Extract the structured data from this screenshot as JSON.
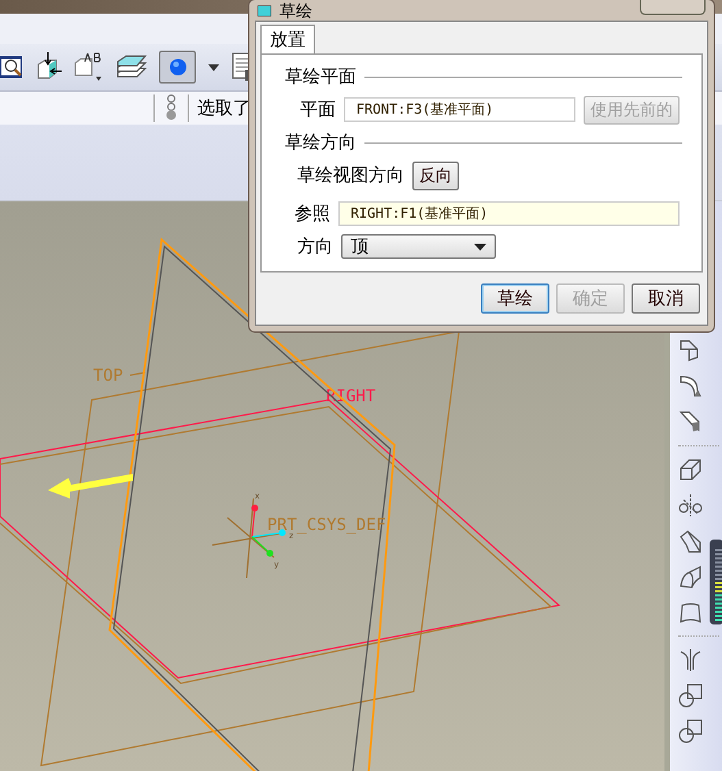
{
  "toolbar": {
    "status_text": "选取了"
  },
  "viewport": {
    "planes": [
      {
        "kind": "front"
      },
      {
        "kind": "top",
        "label": "TOP"
      },
      {
        "kind": "right",
        "label": "RIGHT"
      }
    ],
    "csys_label": "PRT_CSYS_DEF",
    "axes": [
      {
        "label": "x",
        "color": "#ff2040"
      },
      {
        "label": "z",
        "color": "#00e8ff"
      },
      {
        "label": "y",
        "color": "#20e020"
      }
    ]
  },
  "dialog": {
    "title": "草绘",
    "tabs": [
      {
        "label": "放置",
        "selected": true
      }
    ],
    "sketch_plane": {
      "heading": "草绘平面",
      "label": "平面",
      "value": "FRONT:F3(基准平面)",
      "button": {
        "label": "使用先前的",
        "disabled": true
      }
    },
    "sketch_orientation": {
      "heading": "草绘方向",
      "view_label": "草绘视图方向",
      "flip_button": "反向",
      "reference_label": "参照",
      "reference_value": "RIGHT:F1(基准平面)",
      "direction_label": "方向",
      "direction_value": "顶"
    },
    "buttons": [
      {
        "label": "草绘",
        "disabled": false,
        "default": true
      },
      {
        "label": "确定",
        "disabled": true,
        "default": false
      },
      {
        "label": "取消",
        "disabled": false,
        "default": false
      }
    ]
  }
}
